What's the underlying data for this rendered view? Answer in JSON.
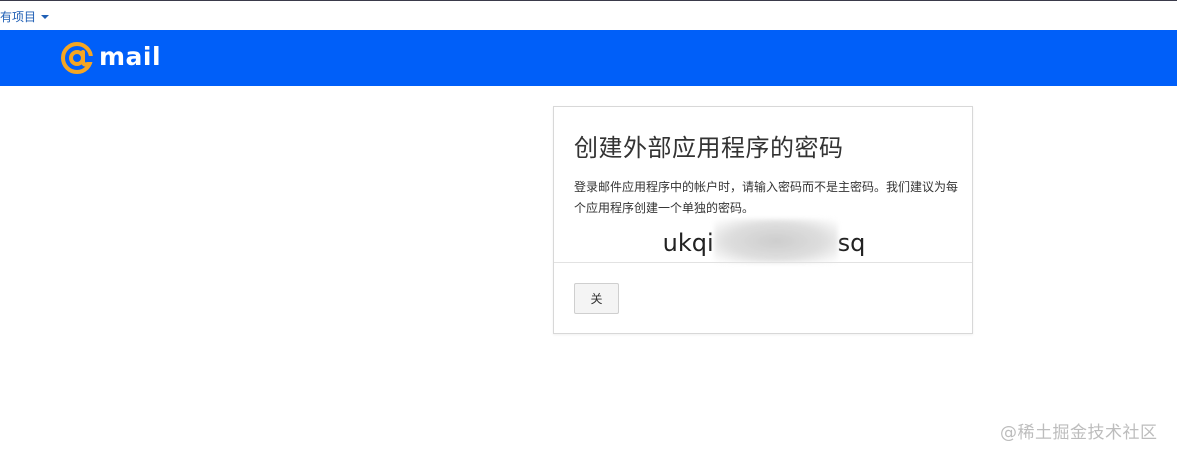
{
  "top_bar": {
    "projects_label": "有项目"
  },
  "header": {
    "brand": "mail",
    "logo_color": "#f5a623",
    "background_color": "#005ff9"
  },
  "dialog": {
    "title": "创建外部应用程序的密码",
    "description": "登录邮件应用程序中的帐户时，请输入密码而不是主密码。我们建议为每个应用程序创建一个单独的密码。",
    "password_prefix": "ukqi",
    "password_suffix": "sq",
    "close_label": "关"
  },
  "watermark": {
    "text": "@稀土掘金技术社区"
  }
}
